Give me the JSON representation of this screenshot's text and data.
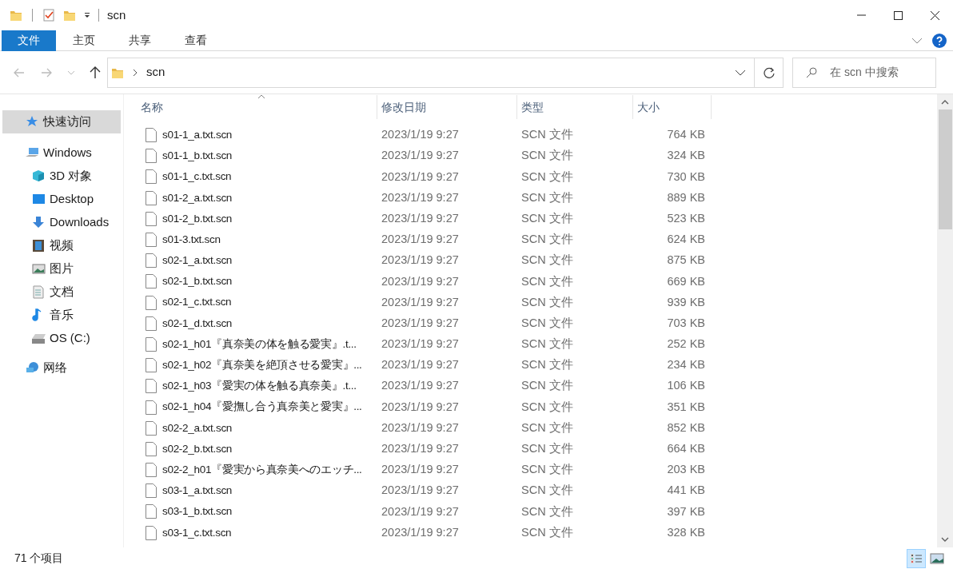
{
  "window": {
    "title": "scn"
  },
  "ribbon_tabs": [
    {
      "label": "文件",
      "selected": true
    },
    {
      "label": "主页",
      "selected": false
    },
    {
      "label": "共享",
      "selected": false
    },
    {
      "label": "查看",
      "selected": false
    }
  ],
  "address_bar": {
    "path": [
      "scn"
    ]
  },
  "search": {
    "placeholder": "在 scn 中搜索"
  },
  "sidebar": {
    "items": [
      {
        "label": "快速访问",
        "kind": "star",
        "selected": true
      },
      {
        "label": "Windows",
        "kind": "pc",
        "selected": false,
        "children": [
          {
            "label": "3D 对象",
            "kind": "cube",
            "selected": false
          },
          {
            "label": "Desktop",
            "kind": "desktop",
            "selected": false
          },
          {
            "label": "Downloads",
            "kind": "download",
            "selected": false
          },
          {
            "label": "视频",
            "kind": "video",
            "selected": false
          },
          {
            "label": "图片",
            "kind": "picture",
            "selected": false
          },
          {
            "label": "文档",
            "kind": "document",
            "selected": false
          },
          {
            "label": "音乐",
            "kind": "music",
            "selected": false
          },
          {
            "label": "OS (C:)",
            "kind": "drive",
            "selected": false
          }
        ]
      },
      {
        "label": "网络",
        "kind": "network",
        "selected": false
      }
    ]
  },
  "table": {
    "columns": [
      "名称",
      "修改日期",
      "类型",
      "大小"
    ],
    "rows": [
      [
        "s01-1_a.txt.scn",
        "2023/1/19 9:27",
        "SCN 文件",
        "764 KB"
      ],
      [
        "s01-1_b.txt.scn",
        "2023/1/19 9:27",
        "SCN 文件",
        "324 KB"
      ],
      [
        "s01-1_c.txt.scn",
        "2023/1/19 9:27",
        "SCN 文件",
        "730 KB"
      ],
      [
        "s01-2_a.txt.scn",
        "2023/1/19 9:27",
        "SCN 文件",
        "889 KB"
      ],
      [
        "s01-2_b.txt.scn",
        "2023/1/19 9:27",
        "SCN 文件",
        "523 KB"
      ],
      [
        "s01-3.txt.scn",
        "2023/1/19 9:27",
        "SCN 文件",
        "624 KB"
      ],
      [
        "s02-1_a.txt.scn",
        "2023/1/19 9:27",
        "SCN 文件",
        "875 KB"
      ],
      [
        "s02-1_b.txt.scn",
        "2023/1/19 9:27",
        "SCN 文件",
        "669 KB"
      ],
      [
        "s02-1_c.txt.scn",
        "2023/1/19 9:27",
        "SCN 文件",
        "939 KB"
      ],
      [
        "s02-1_d.txt.scn",
        "2023/1/19 9:27",
        "SCN 文件",
        "703 KB"
      ],
      [
        "s02-1_h01『真奈美の体を触る愛実』.t...",
        "2023/1/19 9:27",
        "SCN 文件",
        "252 KB"
      ],
      [
        "s02-1_h02『真奈美を絶頂させる愛実』...",
        "2023/1/19 9:27",
        "SCN 文件",
        "234 KB"
      ],
      [
        "s02-1_h03『愛実の体を触る真奈美』.t...",
        "2023/1/19 9:27",
        "SCN 文件",
        "106 KB"
      ],
      [
        "s02-1_h04『愛撫し合う真奈美と愛実』...",
        "2023/1/19 9:27",
        "SCN 文件",
        "351 KB"
      ],
      [
        "s02-2_a.txt.scn",
        "2023/1/19 9:27",
        "SCN 文件",
        "852 KB"
      ],
      [
        "s02-2_b.txt.scn",
        "2023/1/19 9:27",
        "SCN 文件",
        "664 KB"
      ],
      [
        "s02-2_h01『愛実から真奈美へのエッチ...",
        "2023/1/19 9:27",
        "SCN 文件",
        "203 KB"
      ],
      [
        "s03-1_a.txt.scn",
        "2023/1/19 9:27",
        "SCN 文件",
        "441 KB"
      ],
      [
        "s03-1_b.txt.scn",
        "2023/1/19 9:27",
        "SCN 文件",
        "397 KB"
      ],
      [
        "s03-1_c.txt.scn",
        "2023/1/19 9:27",
        "SCN 文件",
        "328 KB"
      ]
    ]
  },
  "status_bar": {
    "item_count": "71 个项目"
  },
  "view_buttons": [
    {
      "kind": "details",
      "selected": true
    },
    {
      "kind": "tiles",
      "selected": false
    }
  ]
}
